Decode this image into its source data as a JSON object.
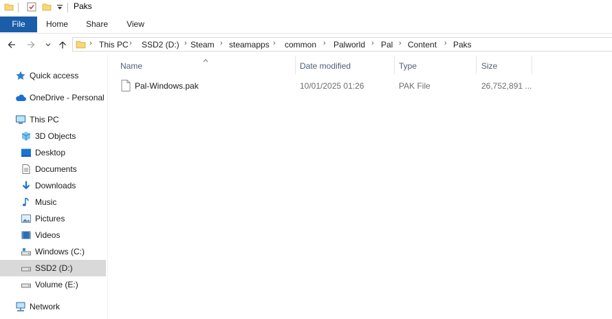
{
  "window": {
    "title": "Paks"
  },
  "ribbon": {
    "tabs": [
      "File",
      "Home",
      "Share",
      "View"
    ]
  },
  "breadcrumb": [
    "This PC",
    "SSD2 (D:)",
    "Steam",
    "steamapps",
    "common",
    "Palworld",
    "Pal",
    "Content",
    "Paks"
  ],
  "sidebar": {
    "items": [
      {
        "label": "Quick access",
        "icon": "star-icon"
      },
      {
        "label": "OneDrive - Personal",
        "icon": "cloud-icon"
      },
      {
        "label": "This PC",
        "icon": "computer-icon"
      },
      {
        "label": "3D Objects",
        "icon": "cube-icon"
      },
      {
        "label": "Desktop",
        "icon": "desktop-icon"
      },
      {
        "label": "Documents",
        "icon": "document-icon"
      },
      {
        "label": "Downloads",
        "icon": "download-icon"
      },
      {
        "label": "Music",
        "icon": "music-icon"
      },
      {
        "label": "Pictures",
        "icon": "pictures-icon"
      },
      {
        "label": "Videos",
        "icon": "videos-icon"
      },
      {
        "label": "Windows (C:)",
        "icon": "drive-icon"
      },
      {
        "label": "SSD2 (D:)",
        "icon": "drive-icon",
        "selected": true
      },
      {
        "label": "Volume (E:)",
        "icon": "drive-icon"
      },
      {
        "label": "Network",
        "icon": "network-icon"
      }
    ]
  },
  "columns": {
    "name": "Name",
    "date": "Date modified",
    "type": "Type",
    "size": "Size"
  },
  "files": [
    {
      "name": "Pal-Windows.pak",
      "date": "10/01/2025 01:26",
      "type": "PAK File",
      "size": "26,752,891 ..."
    }
  ],
  "colors": {
    "accent": "#1a5ea9",
    "selection": "#d9d9d9",
    "header_text": "#4c607a",
    "folder": "#f8d775"
  }
}
